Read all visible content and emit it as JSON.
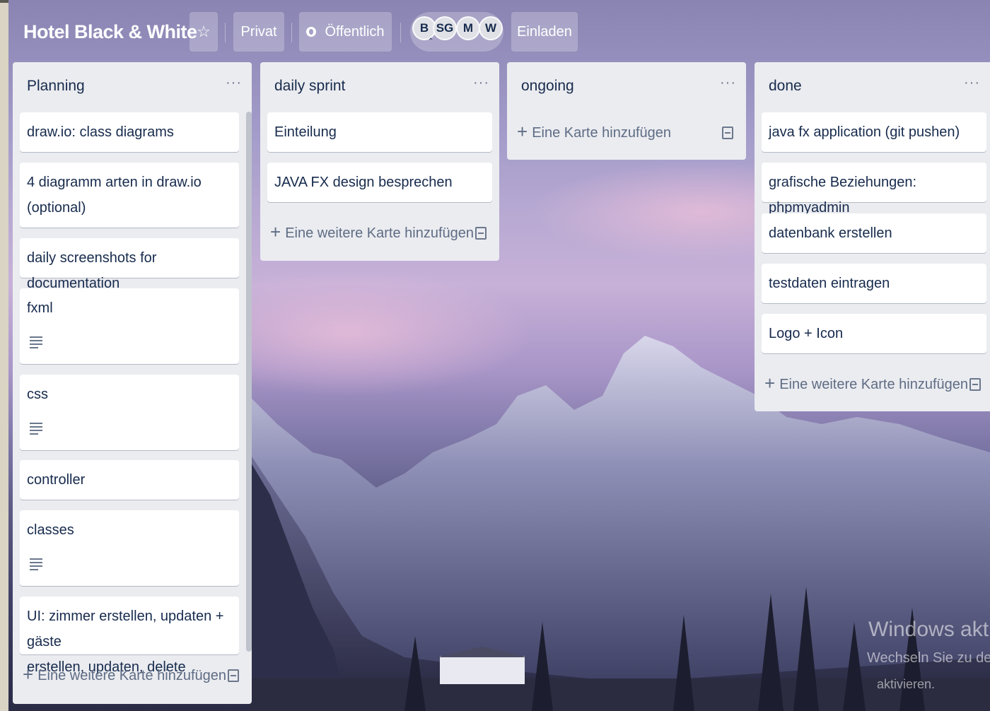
{
  "board": {
    "title": "Hotel Black & White",
    "privacy_label": "Privat",
    "visibility_label": "Öffentlich",
    "invite_label": "Einladen",
    "members": [
      "B",
      "SG",
      "M",
      "W"
    ]
  },
  "lists": [
    {
      "title": "Planning",
      "cards": [
        {
          "lines": [
            "draw.io: class diagrams"
          ],
          "has_description": false
        },
        {
          "lines": [
            "4 diagramm arten in draw.io",
            "(optional)"
          ],
          "has_description": false
        },
        {
          "lines": [
            "daily screenshots for documentation"
          ],
          "has_description": false
        },
        {
          "lines": [
            "fxml"
          ],
          "has_description": true
        },
        {
          "lines": [
            "css"
          ],
          "has_description": true
        },
        {
          "lines": [
            "controller"
          ],
          "has_description": false
        },
        {
          "lines": [
            "classes"
          ],
          "has_description": true
        },
        {
          "lines": [
            "UI: zimmer erstellen, updaten + gäste",
            "erstellen, updaten, delete"
          ],
          "has_description": false
        }
      ],
      "add_label": "Eine weitere Karte hinzufügen"
    },
    {
      "title": "daily sprint",
      "cards": [
        {
          "lines": [
            "Einteilung"
          ],
          "has_description": false
        },
        {
          "lines": [
            "JAVA FX design besprechen"
          ],
          "has_description": false
        }
      ],
      "add_label": "Eine weitere Karte hinzufügen"
    },
    {
      "title": "ongoing",
      "cards": [],
      "add_label": "Eine Karte hinzufügen"
    },
    {
      "title": "done",
      "cards": [
        {
          "lines": [
            "java fx application (git pushen)"
          ],
          "has_description": false
        },
        {
          "lines": [
            "grafische Beziehungen: phpmyadmin"
          ],
          "has_description": false
        },
        {
          "lines": [
            "datenbank erstellen"
          ],
          "has_description": false
        },
        {
          "lines": [
            "testdaten eintragen"
          ],
          "has_description": false
        },
        {
          "lines": [
            "Logo + Icon"
          ],
          "has_description": false
        }
      ],
      "add_label": "Eine weitere Karte hinzufügen"
    }
  ],
  "watermark": {
    "line1": "Windows aktivie",
    "line2": "Wechseln Sie zu den",
    "line3": "aktivieren."
  }
}
